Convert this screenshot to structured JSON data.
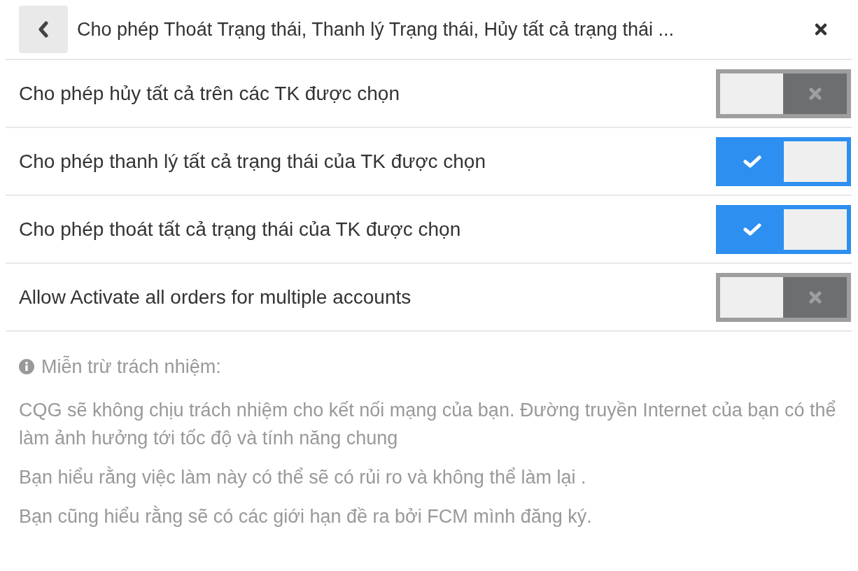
{
  "header": {
    "title": "Cho phép Thoát Trạng thái, Thanh lý Trạng thái, Hủy tất cả trạng thái ..."
  },
  "settings": [
    {
      "label": "Cho phép hủy tất cả trên các TK được chọn",
      "on": false
    },
    {
      "label": "Cho phép thanh lý tất cả trạng thái của TK được chọn",
      "on": true
    },
    {
      "label": "Cho phép thoát tất cả trạng thái của TK được chọn",
      "on": true
    },
    {
      "label": "Allow Activate all orders for multiple accounts",
      "on": false
    }
  ],
  "disclaimer": {
    "title": "Miễn trừ trách nhiệm:",
    "paragraphs": [
      "CQG sẽ không chịu trách nhiệm cho kết nối mạng của bạn. Đường truyền Internet của bạn có thể làm ảnh hưởng tới tốc độ và tính năng chung",
      "Bạn hiểu rằng việc làm này có thể sẽ có rủi ro và không thể làm lại .",
      "Bạn cũng hiểu rằng sẽ có các giới hạn đề ra bởi FCM mình đăng ký."
    ]
  }
}
